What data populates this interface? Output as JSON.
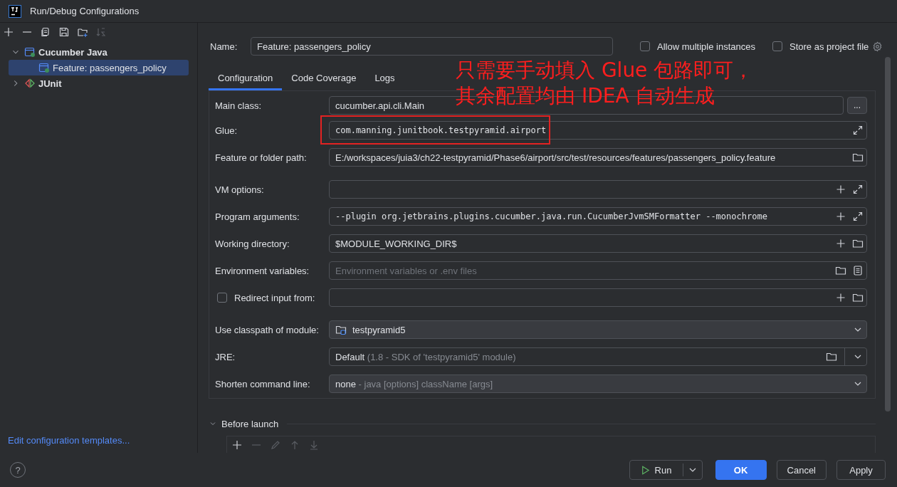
{
  "window": {
    "title": "Run/Debug Configurations"
  },
  "toolbar": [
    {
      "kind": "add",
      "disabled": false
    },
    {
      "kind": "remove",
      "disabled": false
    },
    {
      "kind": "copy",
      "disabled": false
    },
    {
      "kind": "save",
      "disabled": false
    },
    {
      "kind": "folder",
      "disabled": false
    },
    {
      "kind": "sort",
      "disabled": true
    }
  ],
  "tree": [
    {
      "label": "Cucumber Java",
      "kind": "cucumber",
      "expanded": true,
      "selected": false,
      "children": [
        {
          "label": "Feature: passengers_policy",
          "kind": "cucumber",
          "selected": true
        }
      ]
    },
    {
      "label": "JUnit",
      "kind": "junit",
      "expanded": false,
      "selected": false
    }
  ],
  "templates_link": "Edit configuration templates...",
  "name": {
    "label": "Name:",
    "value": "Feature: passengers_policy"
  },
  "options": [
    {
      "label": "Allow multiple instances",
      "checked": false
    },
    {
      "label": "Store as project file",
      "checked": false
    }
  ],
  "tabs": [
    {
      "label": "Configuration",
      "selected": true
    },
    {
      "label": "Code Coverage",
      "selected": false
    },
    {
      "label": "Logs",
      "selected": false
    }
  ],
  "fields": [
    {
      "label": "Main class:",
      "kind": "browse",
      "value": "cucumber.api.cli.Main",
      "button": "...",
      "monospace": false,
      "highlighted": false
    },
    {
      "label": "Glue:",
      "kind": "expand",
      "value": "com.manning.junitbook.testpyramid.airport",
      "monospace": true,
      "highlighted": true
    },
    {
      "label": "Feature or folder path:",
      "kind": "folder",
      "value": "E:/workspaces/juia3/ch22-testpyramid/Phase6/airport/src/test/resources/features/passengers_policy.feature",
      "monospace": false,
      "highlighted": false
    },
    {
      "label": "VM options:",
      "kind": "plus-expand",
      "highlighted": false
    },
    {
      "label": "Program arguments:",
      "kind": "plus-expand",
      "value": " --plugin org.jetbrains.plugins.cucumber.java.run.CucumberJvmSMFormatter --monochrome",
      "monospace": true,
      "highlighted": false
    },
    {
      "label": "Working directory:",
      "kind": "plus-folder",
      "value": "$MODULE_WORKING_DIR$",
      "monospace": false,
      "highlighted": false
    },
    {
      "label": "Environment variables:",
      "kind": "folder-list",
      "placeholder": "Environment variables or .env files",
      "highlighted": false
    },
    {
      "label": "Redirect input from:",
      "kind": "plus-folder",
      "checked": false,
      "highlighted": false
    },
    {
      "label": "Use classpath of module:",
      "kind": "module",
      "value": "testpyramid5",
      "monospace": false,
      "highlighted": false
    },
    {
      "label": "JRE:",
      "kind": "jre",
      "value": "Default",
      "hint": "(1.8 - SDK of 'testpyramid5' module)",
      "monospace": false,
      "highlighted": false
    },
    {
      "label": "Shorten command line:",
      "kind": "dropdown",
      "value": "none",
      "hint": "- java [options] className [args]",
      "monospace": false,
      "highlighted": false
    }
  ],
  "before_launch": {
    "label": "Before launch",
    "expanded": true,
    "tools": [
      {
        "kind": "add",
        "disabled": false
      },
      {
        "kind": "remove",
        "disabled": true
      },
      {
        "kind": "edit",
        "disabled": true
      },
      {
        "kind": "up",
        "disabled": true
      },
      {
        "kind": "down",
        "disabled": true
      }
    ]
  },
  "footer": {
    "help": "?",
    "run": "Run",
    "buttons": [
      {
        "label": "OK",
        "default": true
      },
      {
        "label": "Cancel",
        "default": false
      },
      {
        "label": "Apply",
        "default": false
      }
    ]
  },
  "annotation": {
    "lines": [
      "只需要手动填入 Glue 包路即可，",
      "其余配置均由 IDEA 自动生成"
    ]
  }
}
